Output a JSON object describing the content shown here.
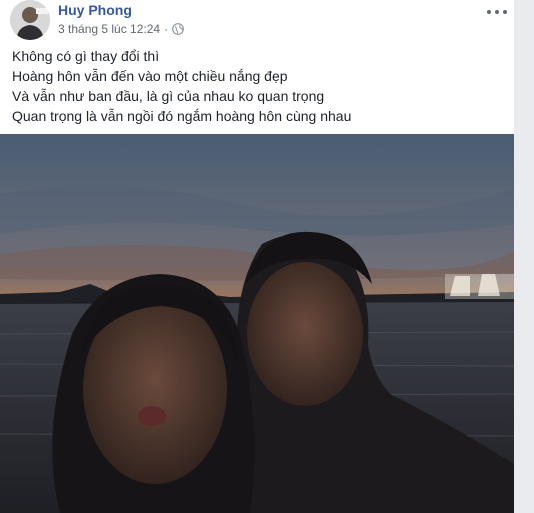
{
  "post": {
    "author_name": "Huy Phong",
    "timestamp": "3 tháng 5 lúc 12:24",
    "separator": "·",
    "privacy_icon": "globe-icon",
    "more_icon": "more-options-icon",
    "lines": [
      "Không có gì thay đổi thì",
      "Hoàng hôn vẫn đến vào một chiều nắng đẹp",
      "Và vẫn như ban đầu, là gì của nhau ko quan trọng",
      "Quan trọng là vẫn ngồi đó ngắm hoàng hôn cùng nhau"
    ]
  },
  "colors": {
    "author_link": "#385898",
    "meta_text": "#616770",
    "body_text": "#1d2129",
    "gutter": "#e9ebee"
  }
}
